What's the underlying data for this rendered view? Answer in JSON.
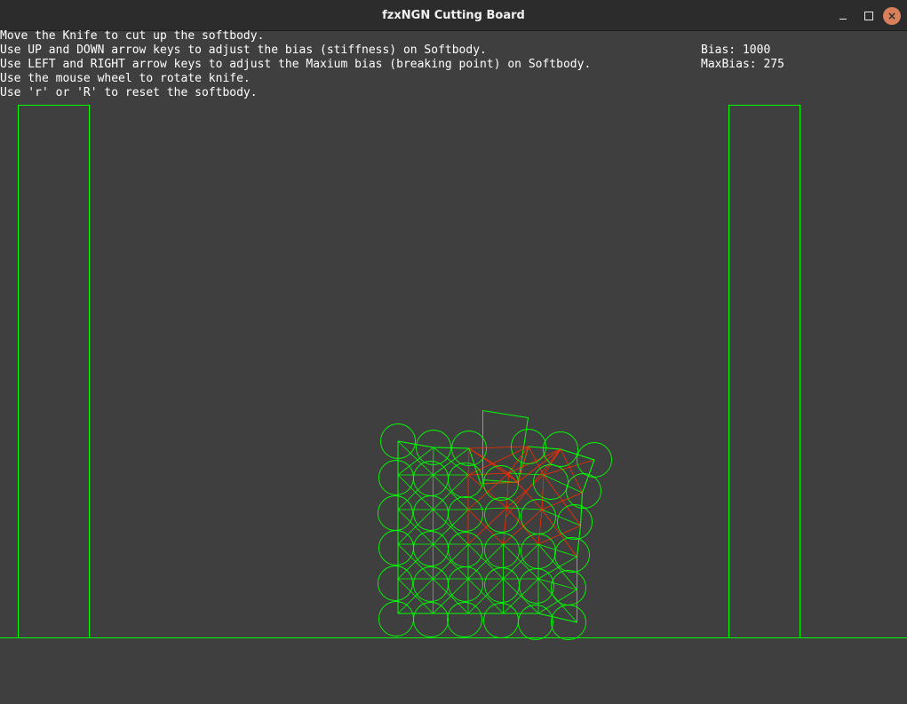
{
  "window": {
    "title": "fzxNGN Cutting Board",
    "minimize_glyph": "",
    "maximize_glyph": "",
    "close_glyph": "×"
  },
  "instructions": [
    "Move the Knife to cut up the softbody.",
    "Use UP and DOWN arrow keys to adjust the bias (stiffness) on Softbody.",
    "Use LEFT and RIGHT arrow keys to adjust the Maxium bias (breaking point) on Softbody.",
    "Use the mouse wheel to rotate knife.",
    "Use 'r' or 'R' to reset the softbody."
  ],
  "stats": {
    "bias_text": "Bias: 1000",
    "maxbias_text": "MaxBias: 275",
    "bias": 1000,
    "max_bias": 275
  },
  "colors": {
    "background": "#3f3f3f",
    "titlebar": "#2c2c2c",
    "body_outline": "#00ff00",
    "stress_links": "#ff2a00",
    "text": "#ffffff",
    "close_button": "#d9805b"
  },
  "scene": {
    "softbody": {
      "rows": 6,
      "columns": 6,
      "description_icon": "softbody-grid"
    }
  }
}
